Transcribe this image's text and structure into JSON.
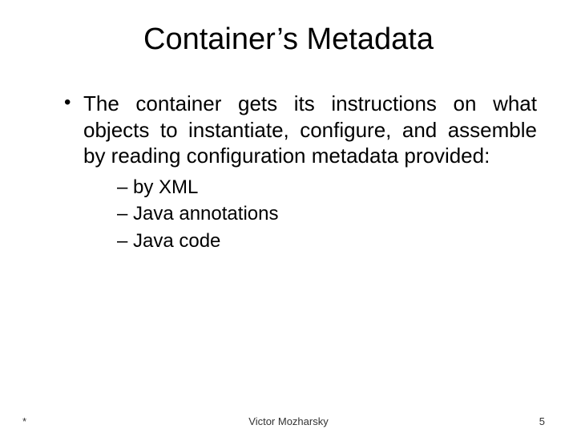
{
  "title": "Container’s Metadata",
  "bullet": "The container gets its instructions on what objects to instantiate, configure, and  assemble  by reading configuration metadata provided:",
  "subitems": [
    "by  XML",
    "Java  annotations",
    "Java  code"
  ],
  "footer": {
    "left": "*",
    "center": "Victor Mozharsky",
    "right": "5"
  }
}
